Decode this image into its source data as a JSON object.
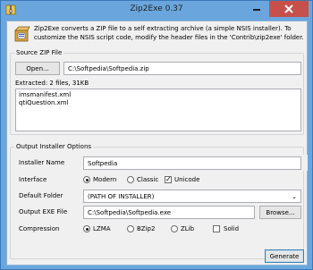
{
  "window": {
    "title": "Zip2Exe 0.37",
    "icon": "zip-archive-icon"
  },
  "intro": {
    "text": "Zip2Exe converts a ZIP file to a self extracting archive (a simple NSIS installer). To customize the NSIS script code, modify the header files in the 'Contrib\\zip2exe' folder.",
    "icon": "installer-box-icon"
  },
  "source": {
    "group_title": "Source ZIP File",
    "open_label": "Open...",
    "zip_path": "C:\\Softpedia\\Softpedia.zip",
    "extracted_label": "Extracted: 2 files, 31KB",
    "files": [
      "imsmanifest.xml",
      "qtiQuestion.xml"
    ]
  },
  "output": {
    "group_title": "Output Installer Options",
    "installer_name_label": "Installer Name",
    "installer_name_value": "Softpedia",
    "interface_label": "Interface",
    "interface_options": [
      "Modern",
      "Classic"
    ],
    "interface_selected": "Modern",
    "unicode_label": "Unicode",
    "unicode_checked": true,
    "default_folder_label": "Default Folder",
    "default_folder_value": "(PATH OF INSTALLER)",
    "output_exe_label": "Output EXE File",
    "output_exe_value": "C:\\Softpedia\\Softpedia.exe",
    "browse_label": "Browse...",
    "compression_label": "Compression",
    "compression_options": [
      "LZMA",
      "BZip2",
      "ZLib"
    ],
    "compression_selected": "LZMA",
    "solid_label": "Solid",
    "solid_checked": false
  },
  "generate_label": "Generate",
  "colors": {
    "frame": "#6aa6dd",
    "close_button": "#c7504a",
    "client": "#f0f0f0"
  }
}
